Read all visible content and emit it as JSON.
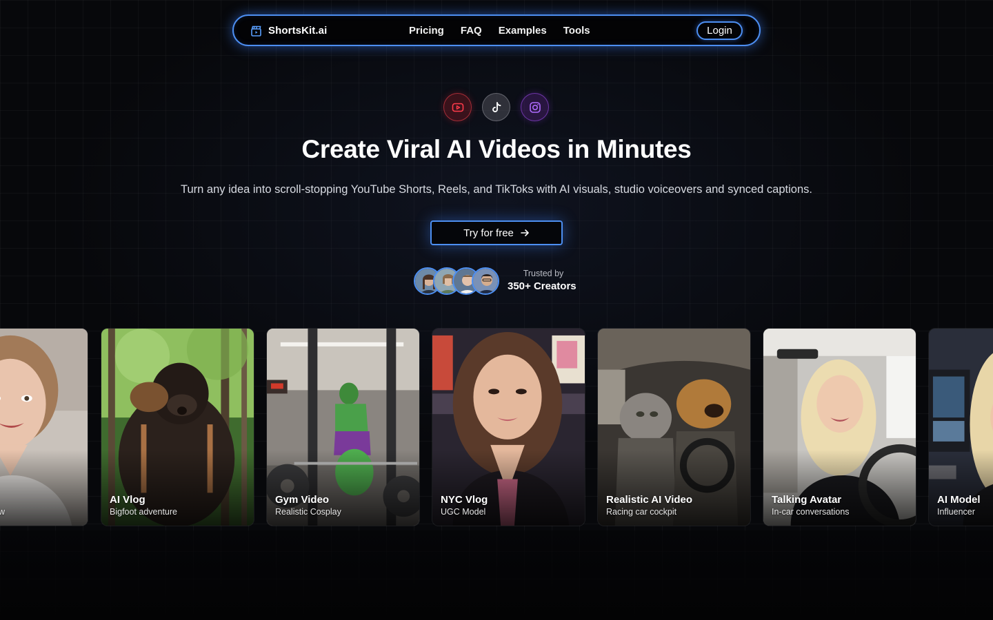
{
  "nav": {
    "brand": "ShortsKit.ai",
    "links": [
      "Pricing",
      "FAQ",
      "Examples",
      "Tools"
    ],
    "login": "Login"
  },
  "platforms": [
    "youtube-icon",
    "tiktok-icon",
    "instagram-icon"
  ],
  "hero": {
    "headline": "Create Viral AI Videos in Minutes",
    "subline": "Turn any idea into scroll-stopping YouTube Shorts, Reels, and TikToks with AI visuals, studio voiceovers and synced captions.",
    "cta": "Try for free"
  },
  "trust": {
    "label": "Trusted by",
    "count": "350+ Creators"
  },
  "cards": [
    {
      "title": "",
      "subtitle": "w"
    },
    {
      "title": "AI Vlog",
      "subtitle": "Bigfoot adventure"
    },
    {
      "title": "Gym Video",
      "subtitle": "Realistic Cosplay"
    },
    {
      "title": "NYC Vlog",
      "subtitle": "UGC Model"
    },
    {
      "title": "Realistic AI Video",
      "subtitle": "Racing car cockpit"
    },
    {
      "title": "Talking Avatar",
      "subtitle": "In-car conversations"
    },
    {
      "title": "AI Model",
      "subtitle": "Influencer"
    }
  ],
  "colors": {
    "accent": "#4d8ff2",
    "background": "#07080b",
    "youtube": "#ff3b4a",
    "instagram": "#b06cff"
  }
}
